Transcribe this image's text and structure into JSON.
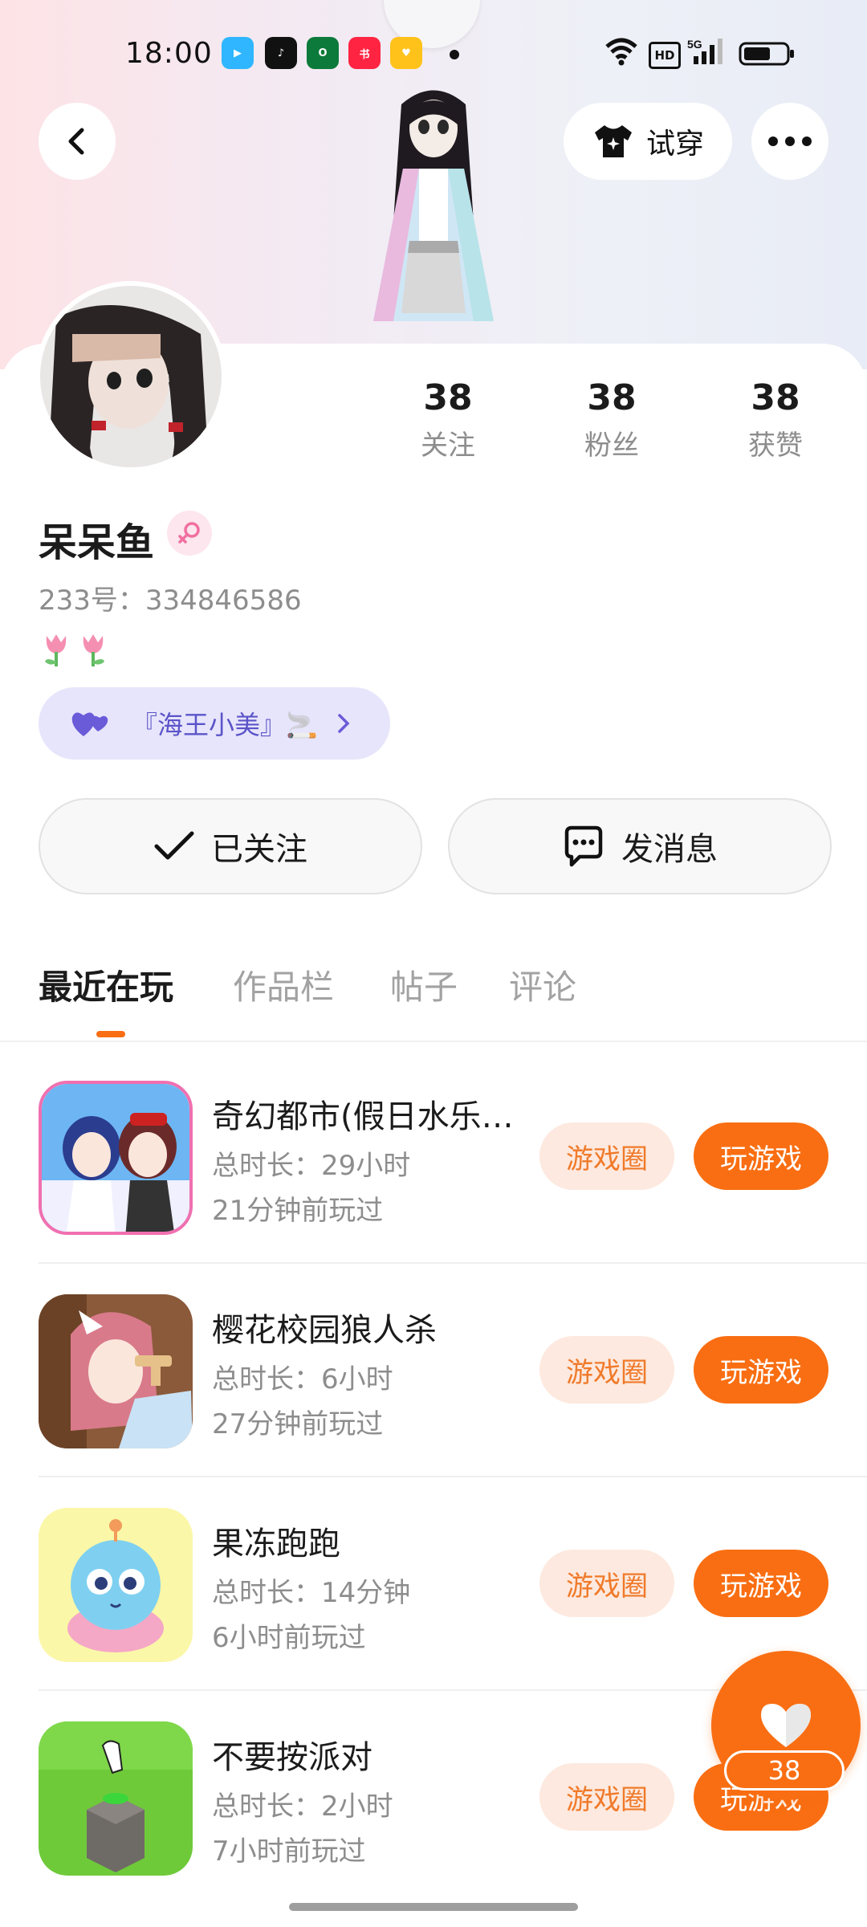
{
  "status": {
    "time": "18:00"
  },
  "header": {
    "try_on_label": "试穿"
  },
  "profile": {
    "name": "呆呆鱼",
    "id_text": "233号：334846586",
    "tag_text": "『海王小美』🚬",
    "stats": [
      {
        "num": "38",
        "label": "关注"
      },
      {
        "num": "38",
        "label": "粉丝"
      },
      {
        "num": "38",
        "label": "获赞"
      }
    ]
  },
  "actions": {
    "followed_label": "已关注",
    "message_label": "发消息"
  },
  "tabs": [
    "最近在玩",
    "作品栏",
    "帖子",
    "评论"
  ],
  "games": [
    {
      "name": "奇幻都市(假日水乐…",
      "duration": "总时长：29小时",
      "last": "21分钟前玩过",
      "circle": "游戏圈",
      "play": "玩游戏"
    },
    {
      "name": "樱花校园狼人杀",
      "duration": "总时长：6小时",
      "last": "27分钟前玩过",
      "circle": "游戏圈",
      "play": "玩游戏"
    },
    {
      "name": "果冻跑跑",
      "duration": "总时长：14分钟",
      "last": "6小时前玩过",
      "circle": "游戏圈",
      "play": "玩游戏"
    },
    {
      "name": "不要按派对",
      "duration": "总时长：2小时",
      "last": "7小时前玩过",
      "circle": "游戏圈",
      "play": "玩游戏"
    }
  ],
  "float": {
    "like_count": "38"
  },
  "colors": {
    "accent": "#f96e12",
    "accent_light": "#fde9df",
    "tag_bg": "#e7e5fb",
    "tag_text": "#5b54c9"
  }
}
